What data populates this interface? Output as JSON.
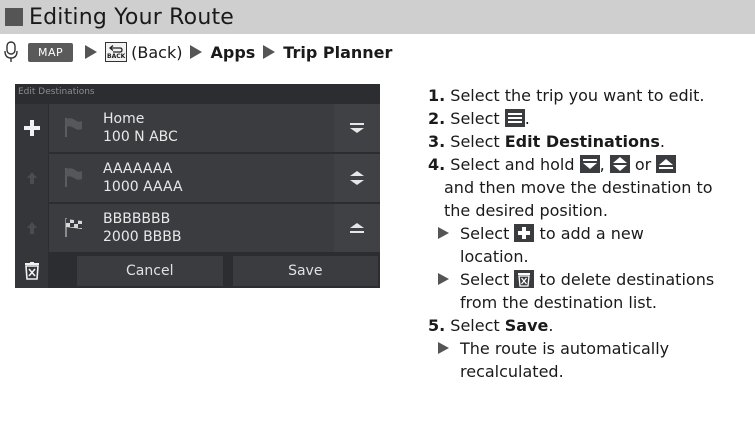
{
  "header": {
    "title": "Editing Your Route"
  },
  "breadcrumb": {
    "map_label": "MAP",
    "back_label": "BACK",
    "back_text": "(Back)",
    "apps": "Apps",
    "trip_planner": "Trip Planner"
  },
  "screen": {
    "title": "Edit Destinations",
    "destinations": [
      {
        "name": "Home",
        "address": "100 N ABC"
      },
      {
        "name": "AAAAAAA",
        "address": "1000 AAAA"
      },
      {
        "name": "BBBBBBB",
        "address": "2000 BBBB"
      }
    ],
    "cancel_label": "Cancel",
    "save_label": "Save"
  },
  "steps": {
    "s1_num": "1.",
    "s1_text": " Select the trip you want to edit.",
    "s2_num": "2.",
    "s2_text": " Select ",
    "s2_end": ".",
    "s3_num": "3.",
    "s3_text": " Select ",
    "s3_bold": "Edit Destinations",
    "s3_end": ".",
    "s4_num": "4.",
    "s4_text": " Select and hold ",
    "s4_comma": ", ",
    "s4_or": " or ",
    "s4_line2": "and then move the destination to",
    "s4_line3": "the desired position.",
    "s4_sub1a": "Select ",
    "s4_sub1b": " to add a new",
    "s4_sub1c": "location.",
    "s4_sub2a": "Select ",
    "s4_sub2b": " to delete destinations",
    "s4_sub2c": "from the destination list.",
    "s5_num": "5.",
    "s5_text": " Select ",
    "s5_bold": "Save",
    "s5_end": ".",
    "s5_sub1": "The route is automatically",
    "s5_sub2": "recalculated."
  },
  "colors": {
    "header_bg": "#cfcfcf",
    "screen_bg": "#2b2d30",
    "row_bg": "#3a3c40"
  }
}
